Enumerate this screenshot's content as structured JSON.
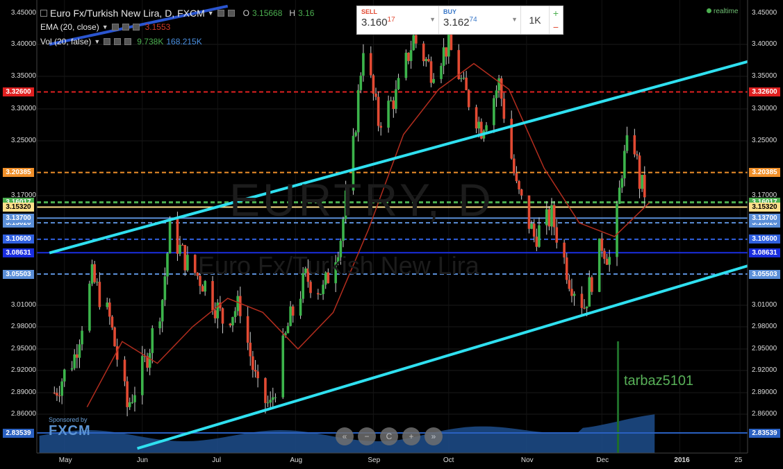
{
  "header": {
    "symbol": "Euro Fx/Turkish New Lira, D, FXCM",
    "ohlc_o_label": "O",
    "ohlc_o_value": "3.15668",
    "ohlc_h_label": "H",
    "ohlc_h_value": "3.16",
    "ema_label": "EMA (20, close)",
    "ema_value": "3.1553",
    "vol_label": "Vol (20, false)",
    "vol_value1": "9.738K",
    "vol_value2": "168.215K",
    "top_left_tick": "3.45000",
    "top_right_tick": "3.45000"
  },
  "trade_panel": {
    "sell_label": "SELL",
    "sell_price_main": "3.160",
    "sell_price_sub": "17",
    "buy_label": "BUY",
    "buy_price_main": "3.162",
    "buy_price_sub": "74",
    "quantity": "1K",
    "plus": "+",
    "minus": "−"
  },
  "status": {
    "realtime": "realtime"
  },
  "watermark": {
    "symbol": "EURTRY, D",
    "description": "Euro Fx/Turkish New Lira"
  },
  "author": "tarbaz5101",
  "sponsor": {
    "label": "Sponsored by",
    "brand": "FXCM"
  },
  "nav_buttons": [
    "«",
    "−",
    "C",
    "+",
    "»"
  ],
  "colors": {
    "background": "#000000",
    "up_candle": "#3cb44b",
    "down_candle": "#e24a33",
    "ema_line": "#b22d1e",
    "channel_line": "#2fe0f0",
    "resistance_red": "#e02020",
    "orange_level": "#f0902a",
    "green_level": "#4caf50",
    "yellow_level": "#ffe08a",
    "blue_level": "#5b8fd8",
    "navy_level": "#1a2ee0",
    "volume": "#1d4d8c"
  },
  "chart_data": {
    "type": "candlestick",
    "symbol": "EURTRY",
    "timeframe": "D",
    "y_ticks": [
      "3.45000",
      "3.40000",
      "3.35000",
      "3.30000",
      "3.25000",
      "3.17000",
      "3.01000",
      "2.98000",
      "2.95000",
      "2.92000",
      "2.89000",
      "2.86000"
    ],
    "y_range": [
      2.82,
      3.46
    ],
    "x_labels": [
      "May",
      "Jun",
      "Jul",
      "Aug",
      "Sep",
      "Oct",
      "Nov",
      "Dec",
      "2016",
      "25"
    ],
    "levels": [
      {
        "value": 3.326,
        "label": "3.32600",
        "style": "dashed",
        "color": "#e02020"
      },
      {
        "value": 3.20385,
        "label": "3.20385",
        "style": "dashed",
        "color": "#f0902a"
      },
      {
        "value": 3.16017,
        "label": "3.16017",
        "style": "dashed",
        "color": "#4caf50"
      },
      {
        "value": 3.1532,
        "label": "3.15320",
        "style": "solid",
        "color": "#ffe08a"
      },
      {
        "value": 3.1302,
        "label": "3.13020",
        "style": "dashed",
        "color": "#5b8fd8"
      },
      {
        "value": 3.137,
        "label": "3.13700",
        "style": "solid",
        "color": "#5b8fd8"
      },
      {
        "value": 3.106,
        "label": "3.10600",
        "style": "dashed",
        "color": "#3060e0"
      },
      {
        "value": 3.08631,
        "label": "3.08631",
        "style": "solid",
        "color": "#1a2ee0"
      },
      {
        "value": 3.05503,
        "label": "3.05503",
        "style": "dashed",
        "color": "#5b8fd8"
      },
      {
        "value": 2.83539,
        "label": "2.83539",
        "style": "solid",
        "color": "#2a60c0"
      }
    ],
    "channel_upper": [
      {
        "date": "2015-04-25",
        "value": 3.086
      },
      {
        "date": "2016-01-28",
        "value": 3.373
      }
    ],
    "channel_lower": [
      {
        "date": "2015-05-30",
        "value": 2.815
      },
      {
        "date": "2016-01-28",
        "value": 3.067
      }
    ],
    "blue_trend": [
      {
        "date": "2015-04-25",
        "value": 3.4
      },
      {
        "date": "2015-07-05",
        "value": 3.46
      }
    ],
    "close_path": [
      {
        "date": "2015-04-27",
        "value": 2.89
      },
      {
        "date": "2015-05-05",
        "value": 2.94
      },
      {
        "date": "2015-05-12",
        "value": 3.05
      },
      {
        "date": "2015-05-19",
        "value": 2.99
      },
      {
        "date": "2015-05-26",
        "value": 2.87
      },
      {
        "date": "2015-06-02",
        "value": 2.93
      },
      {
        "date": "2015-06-09",
        "value": 3.02
      },
      {
        "date": "2015-06-12",
        "value": 3.12
      },
      {
        "date": "2015-06-19",
        "value": 3.07
      },
      {
        "date": "2015-06-26",
        "value": 3.04
      },
      {
        "date": "2015-07-03",
        "value": 2.99
      },
      {
        "date": "2015-07-10",
        "value": 3.01
      },
      {
        "date": "2015-07-17",
        "value": 2.89
      },
      {
        "date": "2015-07-22",
        "value": 2.87
      },
      {
        "date": "2015-07-29",
        "value": 2.98
      },
      {
        "date": "2015-08-05",
        "value": 3.05
      },
      {
        "date": "2015-08-12",
        "value": 3.03
      },
      {
        "date": "2015-08-19",
        "value": 3.11
      },
      {
        "date": "2015-08-24",
        "value": 3.24
      },
      {
        "date": "2015-08-28",
        "value": 3.4
      },
      {
        "date": "2015-09-03",
        "value": 3.28
      },
      {
        "date": "2015-09-10",
        "value": 3.32
      },
      {
        "date": "2015-09-17",
        "value": 3.41
      },
      {
        "date": "2015-09-24",
        "value": 3.36
      },
      {
        "date": "2015-10-01",
        "value": 3.4
      },
      {
        "date": "2015-10-07",
        "value": 3.33
      },
      {
        "date": "2015-10-14",
        "value": 3.27
      },
      {
        "date": "2015-10-21",
        "value": 3.34
      },
      {
        "date": "2015-10-28",
        "value": 3.18
      },
      {
        "date": "2015-11-04",
        "value": 3.11
      },
      {
        "date": "2015-11-11",
        "value": 3.14
      },
      {
        "date": "2015-11-18",
        "value": 3.05
      },
      {
        "date": "2015-11-24",
        "value": 3.01
      },
      {
        "date": "2015-12-01",
        "value": 3.1
      },
      {
        "date": "2015-12-05",
        "value": 3.07
      },
      {
        "date": "2015-12-09",
        "value": 3.21
      },
      {
        "date": "2015-12-13",
        "value": 3.27
      },
      {
        "date": "2015-12-16",
        "value": 3.19
      },
      {
        "date": "2015-12-20",
        "value": 3.16
      }
    ],
    "ema_path": [
      {
        "date": "2015-05-10",
        "value": 2.87
      },
      {
        "date": "2015-05-24",
        "value": 2.96
      },
      {
        "date": "2015-06-07",
        "value": 2.93
      },
      {
        "date": "2015-06-21",
        "value": 2.98
      },
      {
        "date": "2015-07-05",
        "value": 3.02
      },
      {
        "date": "2015-07-19",
        "value": 3.0
      },
      {
        "date": "2015-08-02",
        "value": 2.95
      },
      {
        "date": "2015-08-16",
        "value": 3.0
      },
      {
        "date": "2015-08-30",
        "value": 3.12
      },
      {
        "date": "2015-09-13",
        "value": 3.26
      },
      {
        "date": "2015-09-27",
        "value": 3.33
      },
      {
        "date": "2015-10-11",
        "value": 3.37
      },
      {
        "date": "2015-10-25",
        "value": 3.33
      },
      {
        "date": "2015-11-08",
        "value": 3.21
      },
      {
        "date": "2015-11-22",
        "value": 3.13
      },
      {
        "date": "2015-12-06",
        "value": 3.11
      },
      {
        "date": "2015-12-20",
        "value": 3.16
      }
    ]
  }
}
